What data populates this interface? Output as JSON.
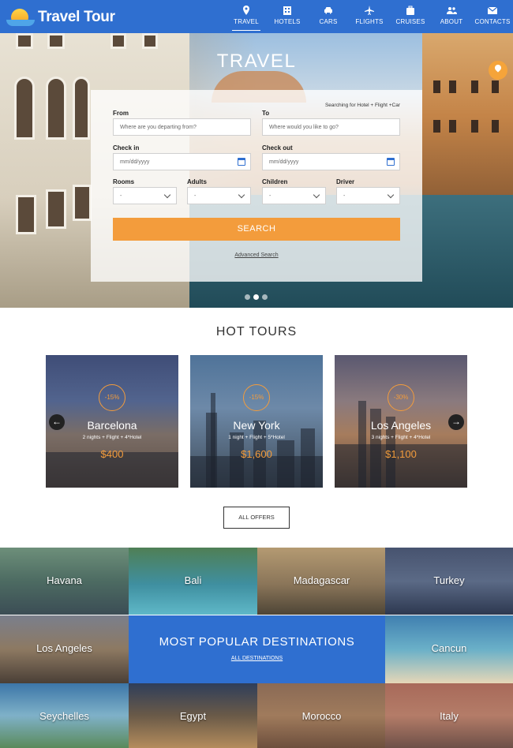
{
  "brand": {
    "name": "Travel Tour"
  },
  "nav": [
    {
      "label": "TRAVEL",
      "icon": "map-pin-icon",
      "active": true
    },
    {
      "label": "HOTELS",
      "icon": "hotel-icon"
    },
    {
      "label": "CARS",
      "icon": "car-icon"
    },
    {
      "label": "FLIGHTS",
      "icon": "plane-icon"
    },
    {
      "label": "CRUISES",
      "icon": "suitcase-icon"
    },
    {
      "label": "ABOUT",
      "icon": "people-icon"
    },
    {
      "label": "CONTACTS",
      "icon": "mail-icon"
    }
  ],
  "hero": {
    "title": "TRAVEL",
    "note": "Searching for Hotel + Flight +Car",
    "from_label": "From",
    "from_placeholder": "Where are you departing from?",
    "to_label": "To",
    "to_placeholder": "Where would you like to go?",
    "checkin_label": "Check in",
    "checkin_value": "mm/dd/yyyy",
    "checkout_label": "Check out",
    "checkout_value": "mm/dd/yyyy",
    "rooms_label": "Rooms",
    "rooms_value": "-",
    "adults_label": "Adults",
    "adults_value": "-",
    "children_label": "Children",
    "children_value": "-",
    "driver_label": "Driver",
    "driver_value": "-",
    "search_label": "SEARCH",
    "advanced_label": "Advanced Search",
    "slides": 3,
    "active_slide": 2
  },
  "hot_tours": {
    "title": "HOT TOURS",
    "tours": [
      {
        "discount": "-15%",
        "city": "Barcelona",
        "meta": "2 nights + Flight + 4*Hotel",
        "price": "$400"
      },
      {
        "discount": "-15%",
        "city": "New York",
        "meta": "1 night + Flight + 5*Hotel",
        "price": "$1,600"
      },
      {
        "discount": "-30%",
        "city": "Los Angeles",
        "meta": "3 nights + Flight + 4*Hotel",
        "price": "$1,100"
      }
    ],
    "all_offers_label": "ALL OFFERS"
  },
  "destinations": {
    "title": "MOST POPULAR DESTINATIONS",
    "link_label": "ALL DESTINATIONS",
    "items": [
      "Havana",
      "Bali",
      "Madagascar",
      "Turkey",
      "Los Angeles",
      "Cancun",
      "Seychelles",
      "Egypt",
      "Morocco",
      "Italy"
    ]
  },
  "colors": {
    "primary": "#2f6fd0",
    "accent": "#f39c3c"
  }
}
